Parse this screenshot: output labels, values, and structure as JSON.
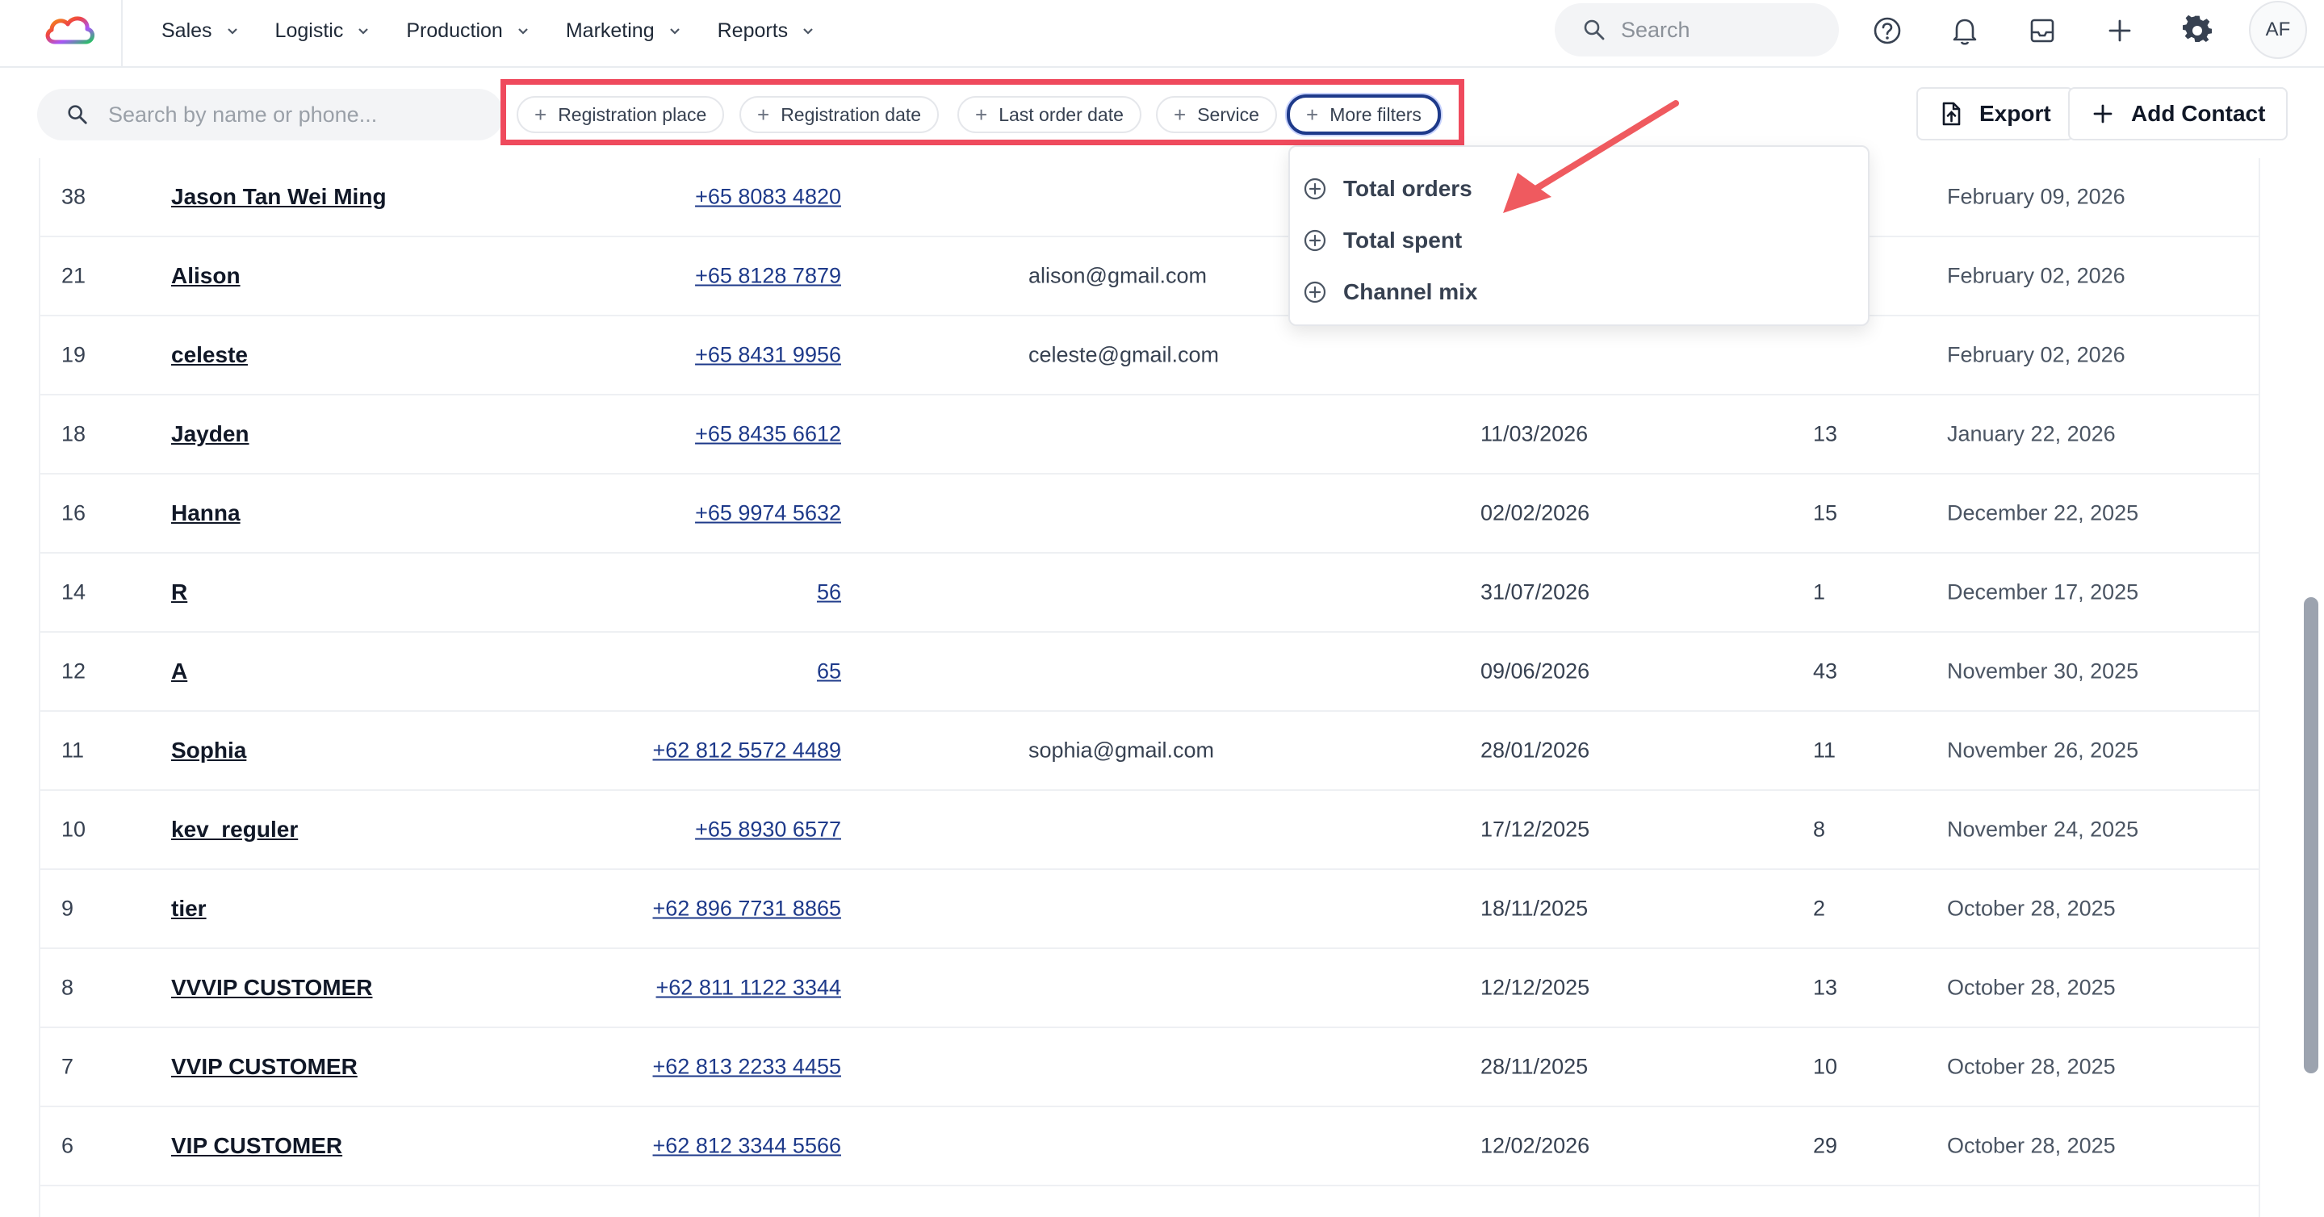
{
  "nav": {
    "items": [
      {
        "label": "Sales"
      },
      {
        "label": "Logistic"
      },
      {
        "label": "Production"
      },
      {
        "label": "Marketing"
      },
      {
        "label": "Reports"
      }
    ],
    "search_placeholder": "Search",
    "avatar_initials": "AF"
  },
  "toolbar": {
    "search_placeholder": "Search by name or phone...",
    "filters": [
      {
        "label": "Registration place"
      },
      {
        "label": "Registration date"
      },
      {
        "label": "Last order date"
      },
      {
        "label": "Service"
      },
      {
        "label": "More filters"
      }
    ],
    "export_label": "Export",
    "add_contact_label": "Add Contact"
  },
  "dropdown": {
    "items": [
      {
        "label": "Total orders"
      },
      {
        "label": "Total spent"
      },
      {
        "label": "Channel mix"
      }
    ]
  },
  "table": {
    "rows": [
      {
        "id": "38",
        "name": "Jason Tan Wei Ming",
        "phone": "+65 8083 4820",
        "email": "",
        "last_order": "",
        "orders": "",
        "registered": "February 09, 2026"
      },
      {
        "id": "21",
        "name": "Alison",
        "phone": "+65 8128 7879",
        "email": "alison@gmail.com",
        "last_order": "",
        "orders": "",
        "registered": "February 02, 2026"
      },
      {
        "id": "19",
        "name": "celeste",
        "phone": "+65 8431 9956",
        "email": "celeste@gmail.com",
        "last_order": "",
        "orders": "",
        "registered": "February 02, 2026"
      },
      {
        "id": "18",
        "name": "Jayden",
        "phone": "+65 8435 6612",
        "email": "",
        "last_order": "11/03/2026",
        "orders": "13",
        "registered": "January 22, 2026"
      },
      {
        "id": "16",
        "name": "Hanna",
        "phone": "+65 9974 5632",
        "email": "",
        "last_order": "02/02/2026",
        "orders": "15",
        "registered": "December 22, 2025"
      },
      {
        "id": "14",
        "name": "R",
        "phone": "56",
        "email": "",
        "last_order": "31/07/2026",
        "orders": "1",
        "registered": "December 17, 2025"
      },
      {
        "id": "12",
        "name": "A",
        "phone": "65",
        "email": "",
        "last_order": "09/06/2026",
        "orders": "43",
        "registered": "November 30, 2025"
      },
      {
        "id": "11",
        "name": "Sophia",
        "phone": "+62 812 5572 4489",
        "email": "sophia@gmail.com",
        "last_order": "28/01/2026",
        "orders": "11",
        "registered": "November 26, 2025"
      },
      {
        "id": "10",
        "name": "kev_reguler",
        "phone": "+65 8930 6577",
        "email": "",
        "last_order": "17/12/2025",
        "orders": "8",
        "registered": "November 24, 2025"
      },
      {
        "id": "9",
        "name": "tier",
        "phone": "+62 896 7731 8865",
        "email": "",
        "last_order": "18/11/2025",
        "orders": "2",
        "registered": "October 28, 2025"
      },
      {
        "id": "8",
        "name": "VVVIP CUSTOMER",
        "phone": "+62 811 1122 3344",
        "email": "",
        "last_order": "12/12/2025",
        "orders": "13",
        "registered": "October 28, 2025"
      },
      {
        "id": "7",
        "name": "VVIP CUSTOMER",
        "phone": "+62 813 2233 4455",
        "email": "",
        "last_order": "28/11/2025",
        "orders": "10",
        "registered": "October 28, 2025"
      },
      {
        "id": "6",
        "name": "VIP CUSTOMER",
        "phone": "+62 812 3344 5566",
        "email": "",
        "last_order": "12/02/2026",
        "orders": "29",
        "registered": "October 28, 2025"
      }
    ]
  }
}
